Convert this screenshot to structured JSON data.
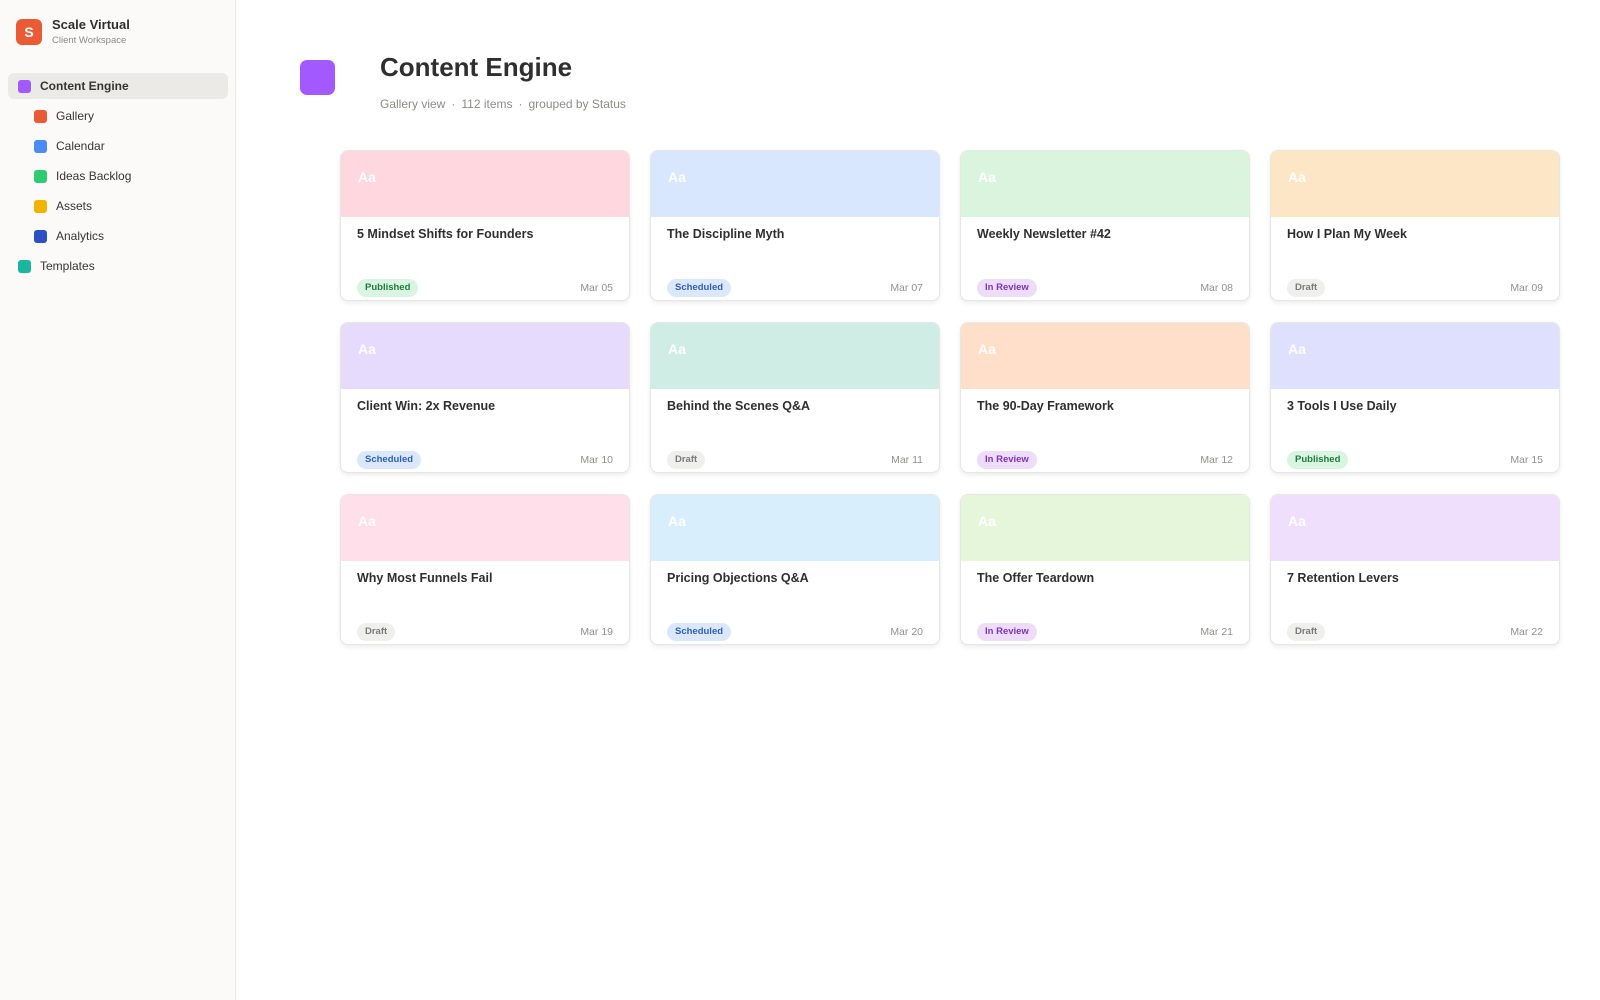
{
  "workspace": {
    "logo_letter": "S",
    "name": "Scale Virtual",
    "subtitle": "Client Workspace",
    "logo_color": "#ea5b35"
  },
  "sidebar": {
    "items": [
      {
        "label": "Content Engine",
        "color": "#a259ff",
        "level": 0,
        "active": true,
        "name": "sidebar-item-content-engine"
      },
      {
        "label": "Gallery",
        "color": "#ea5b35",
        "level": 1,
        "active": false,
        "name": "sidebar-item-gallery"
      },
      {
        "label": "Calendar",
        "color": "#4b8bf5",
        "level": 1,
        "active": false,
        "name": "sidebar-item-calendar"
      },
      {
        "label": "Ideas Backlog",
        "color": "#2ecc71",
        "level": 1,
        "active": false,
        "name": "sidebar-item-ideas-backlog"
      },
      {
        "label": "Assets",
        "color": "#f0b400",
        "level": 1,
        "active": false,
        "name": "sidebar-item-assets"
      },
      {
        "label": "Analytics",
        "color": "#2c4fc4",
        "level": 1,
        "active": false,
        "name": "sidebar-item-analytics"
      },
      {
        "label": "Templates",
        "color": "#1bb5a0",
        "level": 0,
        "active": false,
        "name": "sidebar-item-templates"
      }
    ]
  },
  "page": {
    "icon_color": "#a259ff",
    "title": "Content Engine",
    "meta": {
      "view": "Gallery view",
      "count": "112 items",
      "grouping": "grouped by Status",
      "separator": "·"
    }
  },
  "status_styles": {
    "Published": {
      "bg": "#d9f5e1",
      "fg": "#1f7a3d"
    },
    "Scheduled": {
      "bg": "#dbe8fc",
      "fg": "#2d5fb5"
    },
    "In Review": {
      "bg": "#eedcfb",
      "fg": "#7a35b8"
    },
    "Draft": {
      "bg": "#efefed",
      "fg": "#7a7a76"
    }
  },
  "cards": [
    {
      "cover_text": "Aa",
      "cover_color": "#ffd7df",
      "title": "5 Mindset Shifts for Founders",
      "status": "Published",
      "date": "Mar 05"
    },
    {
      "cover_text": "Aa",
      "cover_color": "#d8e7fd",
      "title": "The Discipline Myth",
      "status": "Scheduled",
      "date": "Mar 07"
    },
    {
      "cover_text": "Aa",
      "cover_color": "#daf4de",
      "title": "Weekly Newsletter #42",
      "status": "In Review",
      "date": "Mar 08"
    },
    {
      "cover_text": "Aa",
      "cover_color": "#fde6c6",
      "title": "How I Plan My Week",
      "status": "Draft",
      "date": "Mar 09"
    },
    {
      "cover_text": "Aa",
      "cover_color": "#e6dbfd",
      "title": "Client Win: 2x Revenue",
      "status": "Scheduled",
      "date": "Mar 10"
    },
    {
      "cover_text": "Aa",
      "cover_color": "#d0ede5",
      "title": "Behind the Scenes Q&A",
      "status": "Draft",
      "date": "Mar 11"
    },
    {
      "cover_text": "Aa",
      "cover_color": "#ffdfc9",
      "title": "The 90-Day Framework",
      "status": "In Review",
      "date": "Mar 12"
    },
    {
      "cover_text": "Aa",
      "cover_color": "#dfe0fd",
      "title": "3 Tools I Use Daily",
      "status": "Published",
      "date": "Mar 15"
    },
    {
      "cover_text": "Aa",
      "cover_color": "#ffdfea",
      "title": "Why Most Funnels Fail",
      "status": "Draft",
      "date": "Mar 19"
    },
    {
      "cover_text": "Aa",
      "cover_color": "#d8eefd",
      "title": "Pricing Objections Q&A",
      "status": "Scheduled",
      "date": "Mar 20"
    },
    {
      "cover_text": "Aa",
      "cover_color": "#e6f6da",
      "title": "The Offer Teardown",
      "status": "In Review",
      "date": "Mar 21"
    },
    {
      "cover_text": "Aa",
      "cover_color": "#f0dffc",
      "title": "7 Retention Levers",
      "status": "Draft",
      "date": "Mar 22"
    }
  ]
}
